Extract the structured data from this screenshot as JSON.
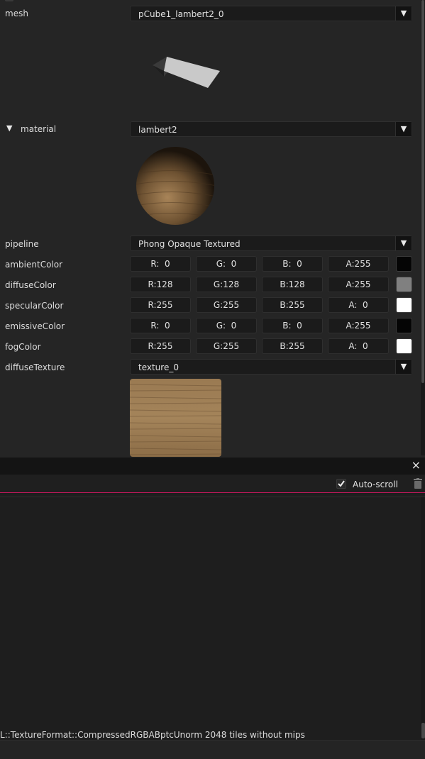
{
  "mesh": {
    "label": "mesh",
    "value": "pCube1_lambert2_0"
  },
  "material": {
    "label": "material",
    "value": "lambert2"
  },
  "pipeline": {
    "label": "pipeline",
    "value": "Phong Opaque Textured"
  },
  "colors": [
    {
      "label": "ambientColor",
      "r": "R:  0",
      "g": "G:  0",
      "b": "B:  0",
      "a": "A:255",
      "swatch": "#050505"
    },
    {
      "label": "diffuseColor",
      "r": "R:128",
      "g": "G:128",
      "b": "B:128",
      "a": "A:255",
      "swatch": "#808080"
    },
    {
      "label": "specularColor",
      "r": "R:255",
      "g": "G:255",
      "b": "B:255",
      "a": "A:  0",
      "swatch": "#ffffff"
    },
    {
      "label": "emissiveColor",
      "r": "R:  0",
      "g": "G:  0",
      "b": "B:  0",
      "a": "A:255",
      "swatch": "#050505"
    },
    {
      "label": "fogColor",
      "r": "R:255",
      "g": "G:255",
      "b": "B:255",
      "a": "A:  0",
      "swatch": "#ffffff"
    }
  ],
  "diffuseTexture": {
    "label": "diffuseTexture",
    "value": "texture_0"
  },
  "console": {
    "close_glyph": "×",
    "autoscroll_label": "Auto-scroll",
    "autoscroll_checked": true,
    "log_line": "L::TextureFormat::CompressedRGBABptcUnorm 2048 tiles without mips"
  },
  "theme": {
    "accent_line": "#c2185b",
    "panel_bg": "#252525",
    "field_bg": "#1b1b1b"
  }
}
